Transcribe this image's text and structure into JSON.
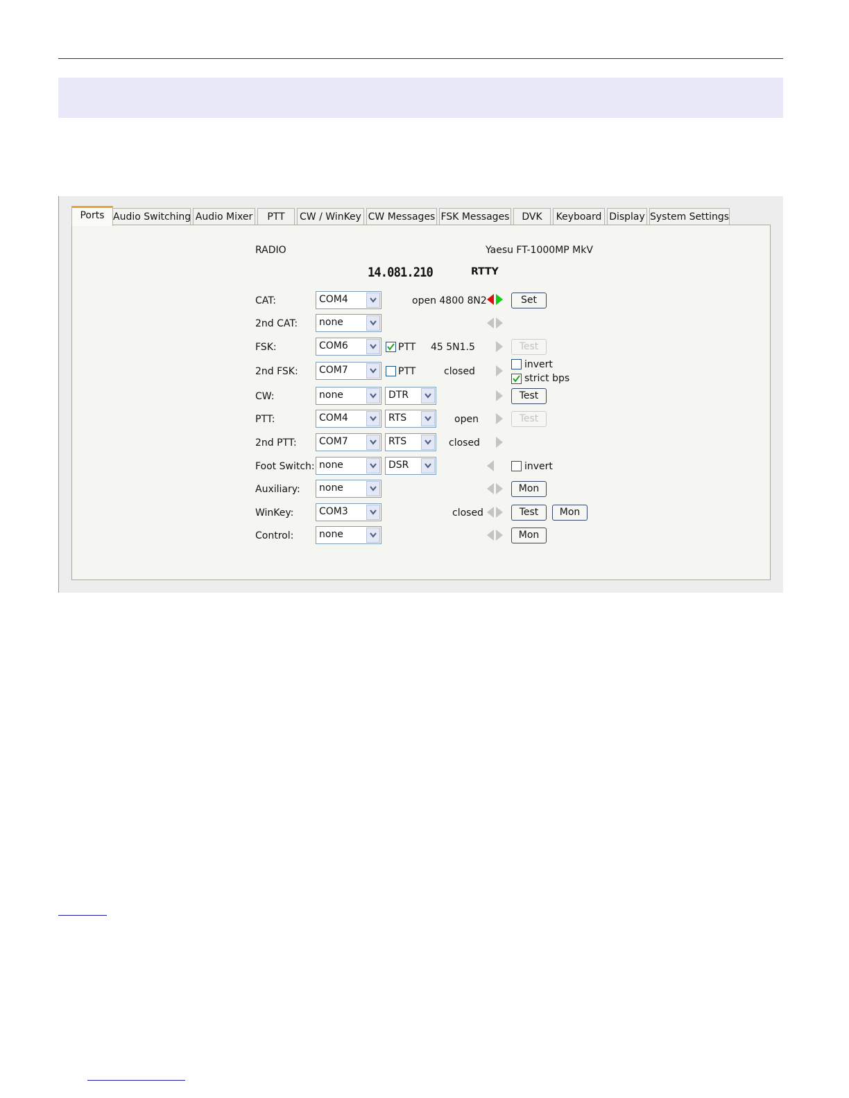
{
  "tabs": [
    "Ports",
    "Audio Switching",
    "Audio Mixer",
    "PTT",
    "CW / WinKey",
    "CW Messages",
    "FSK Messages",
    "DVK",
    "Keyboard",
    "Display",
    "System Settings"
  ],
  "radio": {
    "label": "RADIO",
    "model": "Yaesu FT-1000MP MkV",
    "frequency": "14.081.210",
    "mode": "RTTY"
  },
  "rows": {
    "cat": {
      "label": "CAT:",
      "port": "COM4",
      "status": "open 4800 8N2",
      "button": "Set"
    },
    "cat2": {
      "label": "2nd CAT:",
      "port": "none"
    },
    "fsk": {
      "label": "FSK:",
      "port": "COM6",
      "ptt_label": "PTT",
      "status": "45 5N1.5",
      "button": "Test"
    },
    "fsk2": {
      "label": "2nd FSK:",
      "port": "COM7",
      "ptt_label": "PTT",
      "status": "closed",
      "invert_label": "invert",
      "strict_label": "strict bps"
    },
    "cw": {
      "label": "CW:",
      "port": "none",
      "line": "DTR",
      "button": "Test"
    },
    "ptt": {
      "label": "PTT:",
      "port": "COM4",
      "line": "RTS",
      "status": "open",
      "button": "Test"
    },
    "ptt2": {
      "label": "2nd PTT:",
      "port": "COM7",
      "line": "RTS",
      "status": "closed"
    },
    "foot": {
      "label": "Foot Switch:",
      "port": "none",
      "line": "DSR",
      "invert_label": "invert"
    },
    "aux": {
      "label": "Auxiliary:",
      "port": "none",
      "button": "Mon"
    },
    "winkey": {
      "label": "WinKey:",
      "port": "COM3",
      "status": "closed",
      "test_button": "Test",
      "mon_button": "Mon"
    },
    "control": {
      "label": "Control:",
      "port": "none",
      "button": "Mon"
    }
  }
}
